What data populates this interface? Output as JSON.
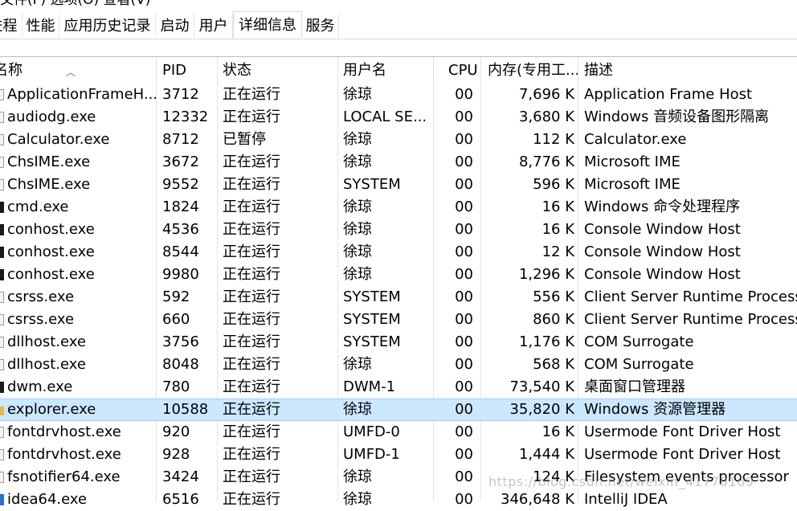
{
  "menu": [
    "文件(F)",
    "选项(O)",
    "查看(V)"
  ],
  "tabs": [
    "进程",
    "性能",
    "应用历史记录",
    "启动",
    "用户",
    "详细信息",
    "服务"
  ],
  "active_tab": "详细信息",
  "columns": {
    "name": "名称",
    "pid": "PID",
    "status": "状态",
    "user": "用户名",
    "cpu": "CPU",
    "memory": "内存(专用工...",
    "description": "描述"
  },
  "rows": [
    {
      "name": "ApplicationFrameH...",
      "pid": "3712",
      "status": "正在运行",
      "user": "徐琼",
      "cpu": "00",
      "mem": "7,696 K",
      "desc": "Application Frame Host",
      "icon": "app-icon"
    },
    {
      "name": "audiodg.exe",
      "pid": "12332",
      "status": "正在运行",
      "user": "LOCAL SE...",
      "cpu": "00",
      "mem": "3,680 K",
      "desc": "Windows 音频设备图形隔离",
      "icon": "app-icon"
    },
    {
      "name": "Calculator.exe",
      "pid": "8712",
      "status": "已暂停",
      "user": "徐琼",
      "cpu": "00",
      "mem": "112 K",
      "desc": "Calculator.exe",
      "icon": "app-icon"
    },
    {
      "name": "ChsIME.exe",
      "pid": "3672",
      "status": "正在运行",
      "user": "徐琼",
      "cpu": "00",
      "mem": "8,776 K",
      "desc": "Microsoft IME",
      "icon": "app-icon"
    },
    {
      "name": "ChsIME.exe",
      "pid": "9552",
      "status": "正在运行",
      "user": "SYSTEM",
      "cpu": "00",
      "mem": "596 K",
      "desc": "Microsoft IME",
      "icon": "app-icon"
    },
    {
      "name": "cmd.exe",
      "pid": "1824",
      "status": "正在运行",
      "user": "徐琼",
      "cpu": "00",
      "mem": "16 K",
      "desc": "Windows 命令处理程序",
      "icon": "console-icon"
    },
    {
      "name": "conhost.exe",
      "pid": "4536",
      "status": "正在运行",
      "user": "徐琼",
      "cpu": "00",
      "mem": "16 K",
      "desc": "Console Window Host",
      "icon": "console-icon"
    },
    {
      "name": "conhost.exe",
      "pid": "8544",
      "status": "正在运行",
      "user": "徐琼",
      "cpu": "00",
      "mem": "12 K",
      "desc": "Console Window Host",
      "icon": "console-icon"
    },
    {
      "name": "conhost.exe",
      "pid": "9980",
      "status": "正在运行",
      "user": "徐琼",
      "cpu": "00",
      "mem": "1,296 K",
      "desc": "Console Window Host",
      "icon": "console-icon"
    },
    {
      "name": "csrss.exe",
      "pid": "592",
      "status": "正在运行",
      "user": "SYSTEM",
      "cpu": "00",
      "mem": "556 K",
      "desc": "Client Server Runtime Process",
      "icon": "app-icon"
    },
    {
      "name": "csrss.exe",
      "pid": "660",
      "status": "正在运行",
      "user": "SYSTEM",
      "cpu": "00",
      "mem": "860 K",
      "desc": "Client Server Runtime Process",
      "icon": "app-icon"
    },
    {
      "name": "dllhost.exe",
      "pid": "3756",
      "status": "正在运行",
      "user": "SYSTEM",
      "cpu": "00",
      "mem": "1,176 K",
      "desc": "COM Surrogate",
      "icon": "app-icon"
    },
    {
      "name": "dllhost.exe",
      "pid": "8048",
      "status": "正在运行",
      "user": "徐琼",
      "cpu": "00",
      "mem": "568 K",
      "desc": "COM Surrogate",
      "icon": "app-icon"
    },
    {
      "name": "dwm.exe",
      "pid": "780",
      "status": "正在运行",
      "user": "DWM-1",
      "cpu": "00",
      "mem": "73,540 K",
      "desc": "桌面窗口管理器",
      "icon": "console-icon"
    },
    {
      "name": "explorer.exe",
      "pid": "10588",
      "status": "正在运行",
      "user": "徐琼",
      "cpu": "00",
      "mem": "35,820 K",
      "desc": "Windows 资源管理器",
      "icon": "folder-icon",
      "selected": true
    },
    {
      "name": "fontdrvhost.exe",
      "pid": "920",
      "status": "正在运行",
      "user": "UMFD-0",
      "cpu": "00",
      "mem": "16 K",
      "desc": "Usermode Font Driver Host",
      "icon": "app-icon"
    },
    {
      "name": "fontdrvhost.exe",
      "pid": "928",
      "status": "正在运行",
      "user": "UMFD-1",
      "cpu": "00",
      "mem": "1,444 K",
      "desc": "Usermode Font Driver Host",
      "icon": "app-icon"
    },
    {
      "name": "fsnotifier64.exe",
      "pid": "3424",
      "status": "正在运行",
      "user": "徐琼",
      "cpu": "00",
      "mem": "124 K",
      "desc": "Filesystem events processor",
      "icon": "app-icon"
    },
    {
      "name": "idea64.exe",
      "pid": "6516",
      "status": "正在运行",
      "user": "徐琼",
      "cpu": "00",
      "mem": "346,648 K",
      "desc": "IntelliJ IDEA",
      "icon": "idea-icon"
    }
  ],
  "watermark": "https://blog.csdn.net/weixin_41770169"
}
